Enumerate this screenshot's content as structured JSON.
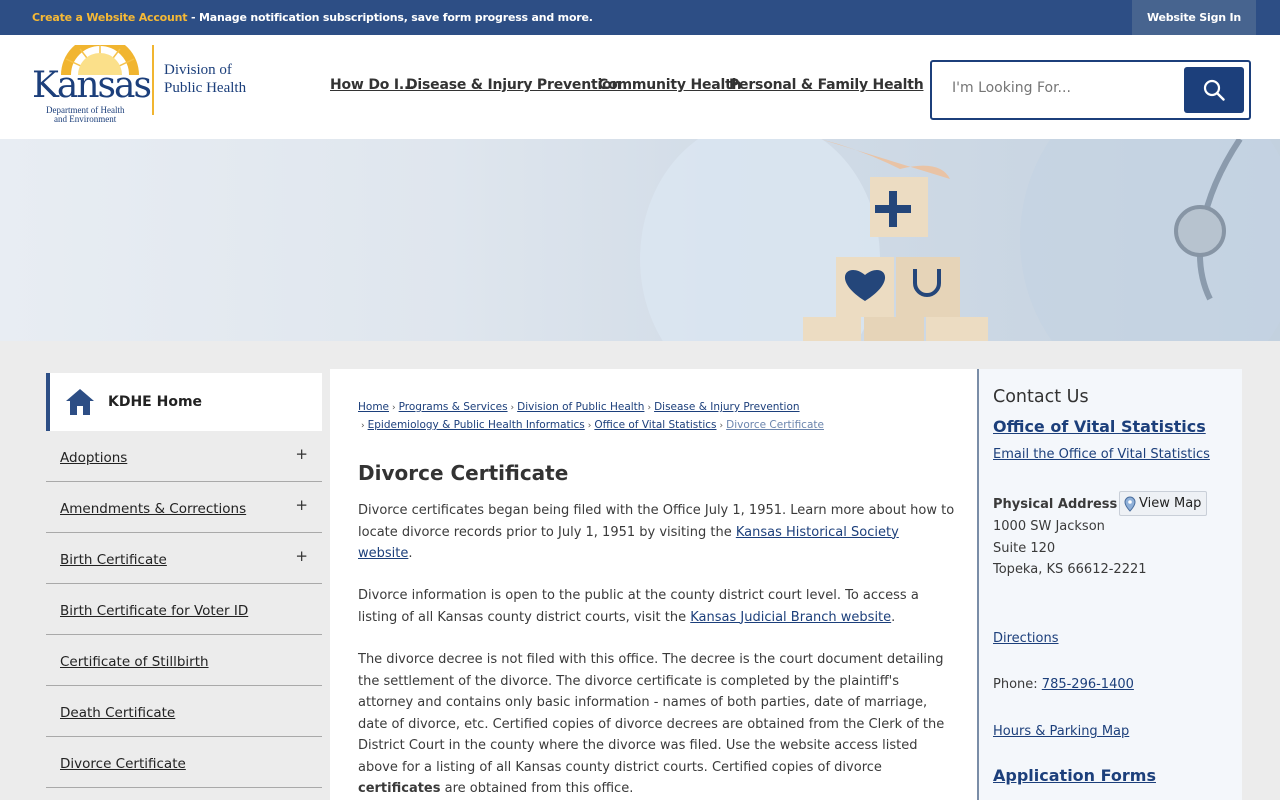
{
  "topbar": {
    "link": "Create a Website Account",
    "text": " - Manage notification subscriptions, save form progress and more.",
    "signin": "Website Sign In"
  },
  "logo": {
    "word": "Kansas",
    "sub1": "Department of Health",
    "sub2": "and Environment",
    "division1": "Division of",
    "division2": "Public Health"
  },
  "nav": {
    "items": [
      "How Do I...",
      "Disease & Injury Prevention",
      "Community Health",
      "Personal & Family Health"
    ]
  },
  "search": {
    "placeholder": "I'm Looking For..."
  },
  "sidenav": {
    "home": "KDHE Home",
    "items": [
      {
        "label": "Adoptions",
        "expand": "+"
      },
      {
        "label": "Amendments & Corrections",
        "expand": "+"
      },
      {
        "label": "Birth Certificate",
        "expand": "+"
      },
      {
        "label": "Birth Certificate for Voter ID",
        "expand": ""
      },
      {
        "label": "Certificate of Stillbirth",
        "expand": ""
      },
      {
        "label": "Death Certificate",
        "expand": ""
      },
      {
        "label": "Divorce Certificate",
        "expand": ""
      }
    ]
  },
  "breadcrumb": [
    "Home",
    "Programs & Services",
    "Division of Public Health",
    "Disease & Injury Prevention",
    "Epidemiology & Public Health Informatics",
    "Office of Vital Statistics",
    "Divorce Certificate"
  ],
  "main": {
    "title": "Divorce Certificate",
    "p1_a": "Divorce certificates began being filed with the Office July 1, 1951. Learn more about how to locate divorce records prior to July 1, 1951 by visiting the ",
    "p1_link": "Kansas Historical Society website",
    "p1_b": ".",
    "p2_a": "Divorce information is open to the public at the county district court level. To access a listing of all Kansas county district courts, visit the ",
    "p2_link": "Kansas Judicial Branch website",
    "p2_b": ".",
    "p3_a": "The divorce decree is not filed with this office. The decree is the court document detailing the settlement of the divorce. The divorce certificate is completed by the plaintiff's attorney and contains only basic information - names of both parties, date of marriage, date of divorce, etc. Certified copies of divorce decrees are obtained from the Clerk of the District Court in the county where the divorce was filed. Use the website access listed above for a listing of all Kansas county district courts. Certified copies of divorce ",
    "p3_bold": "certificates",
    "p3_b": " are obtained from this office."
  },
  "contact": {
    "heading": "Contact Us",
    "office": "Office of Vital Statistics",
    "email": "Email the Office of Vital Statistics",
    "address_label": "Physical Address",
    "view_map": "View Map",
    "address1": "1000 SW Jackson",
    "address2": "Suite 120",
    "address3": "Topeka, KS 66612-2221",
    "directions": "Directions",
    "phone_label": "Phone: ",
    "phone": "785-296-1400",
    "hours": "Hours & Parking Map",
    "forms": "Application Forms"
  }
}
